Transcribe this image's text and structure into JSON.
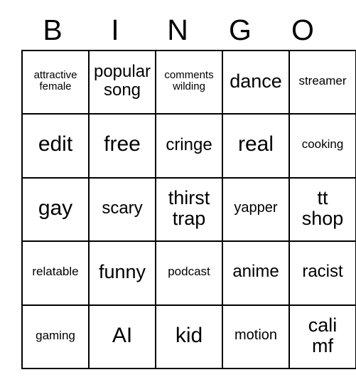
{
  "card": {
    "type": "bingo-card",
    "columns": 5,
    "rows": 5,
    "header_letters": [
      "B",
      "I",
      "N",
      "G",
      "O"
    ],
    "colors": {
      "background": "#ffffff",
      "text": "#000000",
      "grid_line": "#000000"
    },
    "cells": [
      [
        {
          "text": "attractive\nfemale",
          "size": "fs-xs"
        },
        {
          "text": "popular\nsong",
          "size": "fs-lg"
        },
        {
          "text": "comments\nwilding",
          "size": "fs-xs"
        },
        {
          "text": "dance",
          "size": "fs-xl"
        },
        {
          "text": "streamer",
          "size": "fs-sm"
        }
      ],
      [
        {
          "text": "edit",
          "size": "fs-xxl"
        },
        {
          "text": "free",
          "size": "fs-xxl"
        },
        {
          "text": "cringe",
          "size": "fs-lg"
        },
        {
          "text": "real",
          "size": "fs-xxl"
        },
        {
          "text": "cooking",
          "size": "fs-sm"
        }
      ],
      [
        {
          "text": "gay",
          "size": "fs-xxl"
        },
        {
          "text": "scary",
          "size": "fs-lg"
        },
        {
          "text": "thirst\ntrap",
          "size": "fs-xl"
        },
        {
          "text": "yapper",
          "size": "fs-md"
        },
        {
          "text": "tt\nshop",
          "size": "fs-xl"
        }
      ],
      [
        {
          "text": "relatable",
          "size": "fs-sm"
        },
        {
          "text": "funny",
          "size": "fs-xl"
        },
        {
          "text": "podcast",
          "size": "fs-sm"
        },
        {
          "text": "anime",
          "size": "fs-lg"
        },
        {
          "text": "racist",
          "size": "fs-lg"
        }
      ],
      [
        {
          "text": "gaming",
          "size": "fs-sm"
        },
        {
          "text": "AI",
          "size": "fs-xxl"
        },
        {
          "text": "kid",
          "size": "fs-xxl"
        },
        {
          "text": "motion",
          "size": "fs-md"
        },
        {
          "text": "cali\nmf",
          "size": "fs-xl"
        }
      ]
    ]
  }
}
